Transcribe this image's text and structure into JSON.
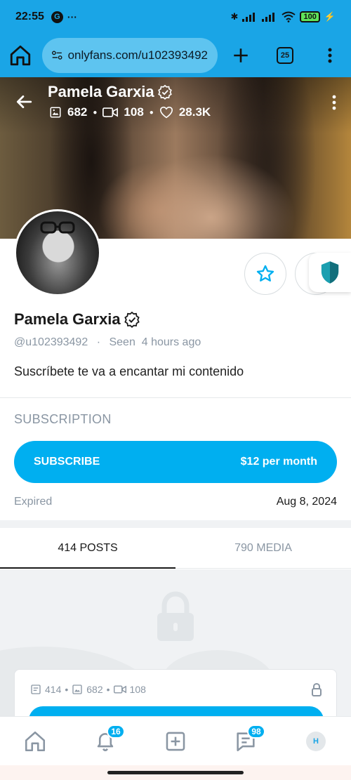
{
  "status_bar": {
    "time": "22:55",
    "g_icon": "G",
    "dots": "···",
    "battery": "100"
  },
  "browser": {
    "url": "onlyfans.com/u102393492",
    "tab_count": "25"
  },
  "cover": {
    "name": "Pamela Garxia",
    "photos": "682",
    "videos": "108",
    "likes": "28.3K"
  },
  "profile": {
    "name": "Pamela Garxia",
    "username": "@u102393492",
    "seen": "Seen  4 hours ago",
    "bio": "Suscríbete te va a encantar mi contenido"
  },
  "subscription": {
    "heading": "SUBSCRIPTION",
    "button_label": "SUBSCRIBE",
    "price": "$12 per month",
    "expired_label": "Expired",
    "expired_date": "Aug 8, 2024"
  },
  "tabs": [
    {
      "label": "414 POSTS"
    },
    {
      "label": "790 MEDIA"
    }
  ],
  "locked_card": {
    "posts": "414",
    "photos": "682",
    "videos": "108"
  },
  "nav": {
    "notifications_badge": "16",
    "messages_badge": "98",
    "avatar_initial": "H"
  },
  "colors": {
    "accent": "#00aff0",
    "browser_bar": "#1aa5e6",
    "muted": "#8a96a3"
  },
  "icons": [
    "home-icon",
    "plus-icon",
    "tab-switcher-icon",
    "more-icon",
    "back-icon",
    "image-icon",
    "video-icon",
    "heart-icon",
    "verified-icon",
    "star-icon",
    "shield-icon",
    "lock-icon",
    "bell-icon",
    "add-post-icon",
    "messages-icon"
  ]
}
